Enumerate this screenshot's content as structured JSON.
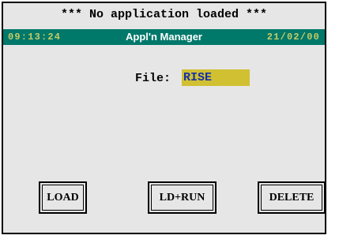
{
  "status_title": "*** No application loaded ***",
  "header": {
    "time": "09:13:24",
    "title": "Appl'n Manager",
    "date": "21/02/00"
  },
  "file": {
    "label": "File:",
    "value": "RISE"
  },
  "buttons": {
    "load": "LOAD",
    "ld_run": "LD+RUN",
    "delete": "DELETE"
  },
  "colors": {
    "header_bar": "#00786a",
    "header_accent": "#c8cc66",
    "field_background": "#d1c031",
    "field_text": "#1530a8",
    "panel_background": "#e6e6e6"
  }
}
